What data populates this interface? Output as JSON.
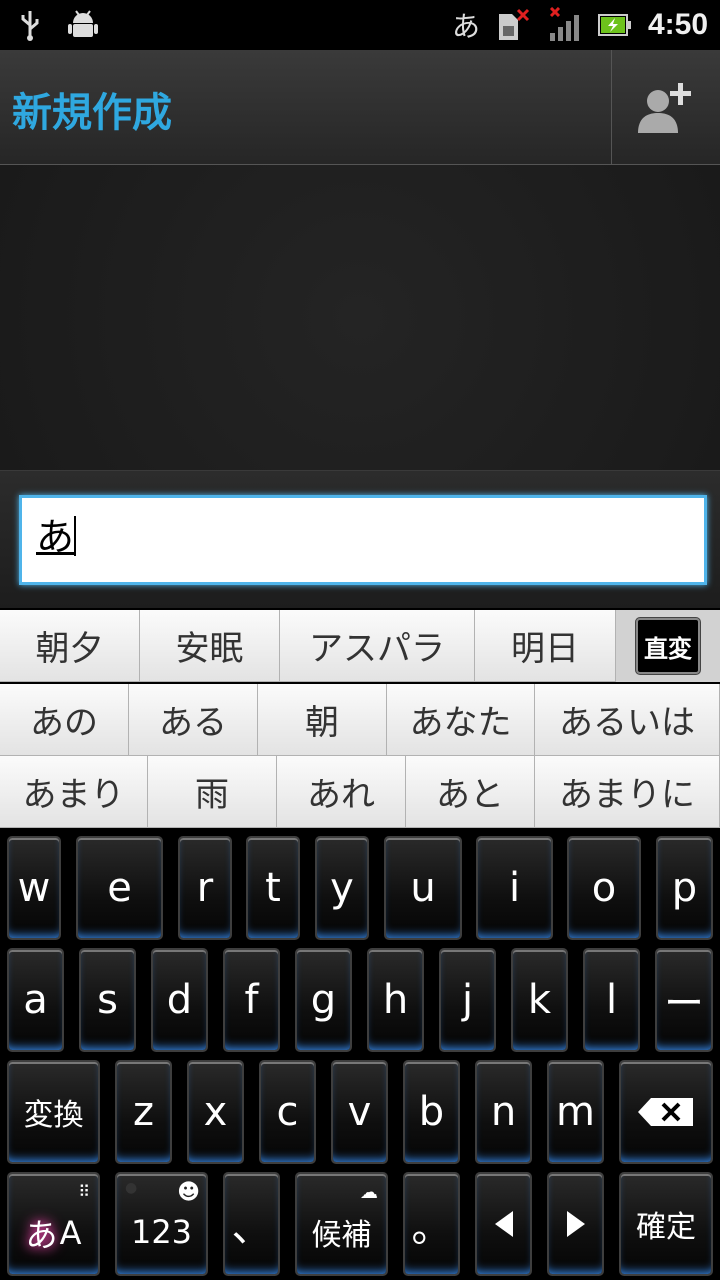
{
  "status_bar": {
    "ime": "あ",
    "time": "4:50",
    "icons": [
      "usb-icon",
      "android-debug-icon",
      "sim-error-icon",
      "signal-none-icon",
      "battery-charging-icon"
    ]
  },
  "action_bar": {
    "title": "新規作成",
    "add_contact_icon": "person-add-icon"
  },
  "compose": {
    "text": "あ"
  },
  "candidates": {
    "row1": [
      "朝夕",
      "安眠",
      "アスパラ",
      "明日"
    ],
    "direct_convert_label": "直変",
    "row2": [
      "あの",
      "ある",
      "朝",
      "あなた",
      "あるいは"
    ],
    "row3": [
      "あまり",
      "雨",
      "あれ",
      "あと",
      "あまりに"
    ]
  },
  "keyboard": {
    "row1": [
      "w",
      "e",
      "r",
      "t",
      "y",
      "u",
      "i",
      "o",
      "p"
    ],
    "row2": [
      "a",
      "s",
      "d",
      "f",
      "g",
      "h",
      "j",
      "k",
      "l",
      "ー"
    ],
    "row3": [
      "z",
      "x",
      "c",
      "v",
      "b",
      "n",
      "m"
    ],
    "convert_label": "変換",
    "mode_kana": "あ",
    "mode_alpha": "A",
    "numbers_label": "123",
    "comma": "、",
    "candidates_label": "候補",
    "period": "。",
    "confirm_label": "確定",
    "accent_color": "#3a8df0"
  }
}
